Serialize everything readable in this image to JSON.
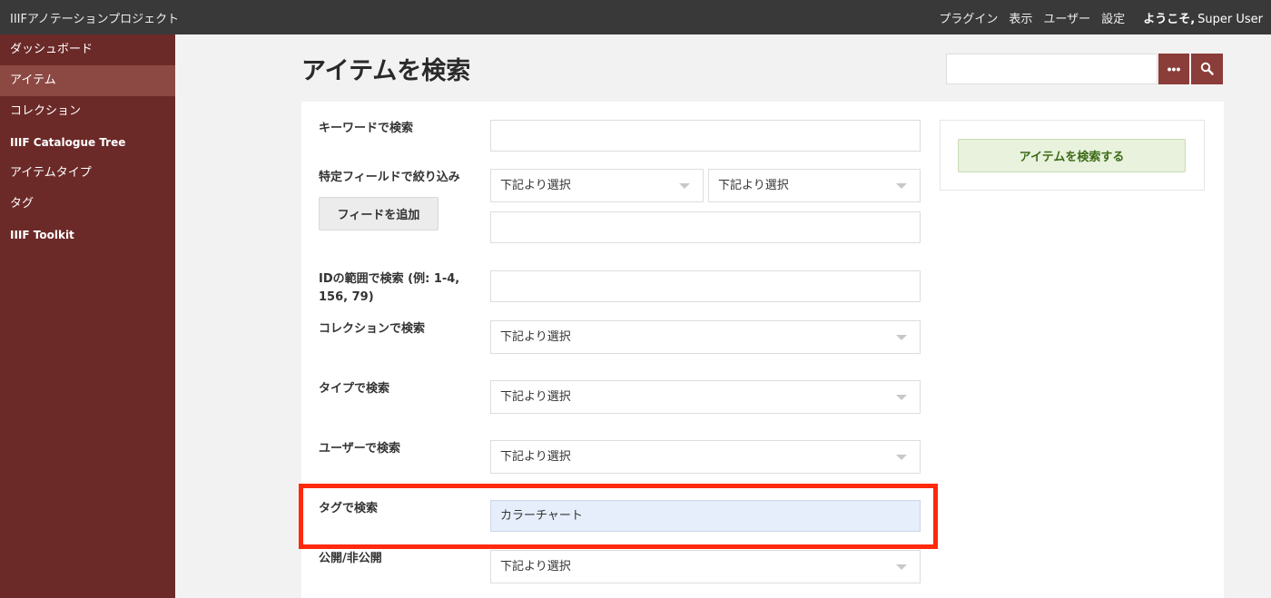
{
  "topbar": {
    "app_title": "IIIFアノテーションプロジェクト",
    "nav": [
      "プラグイン",
      "表示",
      "ユーザー",
      "設定"
    ],
    "welcome_label": "ようこそ,",
    "username": "Super User"
  },
  "sidebar": {
    "items": [
      {
        "label": "ダッシュボード"
      },
      {
        "label": "アイテム",
        "active": true
      },
      {
        "label": "コレクション"
      },
      {
        "label": "IIIF Catalogue Tree"
      },
      {
        "label": "アイテムタイプ"
      },
      {
        "label": "タグ"
      },
      {
        "label": "IIIF Toolkit"
      }
    ]
  },
  "page": {
    "title": "アイテムを検索",
    "top_search_value": "",
    "advanced_button_label": "•••"
  },
  "form": {
    "keyword_label": "キーワードで検索",
    "keyword_value": "",
    "field_filter_label": "特定フィールドで絞り込み",
    "field_select_1": "下記より選択",
    "field_select_2": "下記より選択",
    "field_value": "",
    "add_field_button": "フィードを追加",
    "id_range_label": "IDの範囲で検索 (例: 1-4, 156, 79)",
    "id_range_value": "",
    "collection_label": "コレクションで検索",
    "collection_select": "下記より選択",
    "type_label": "タイプで検索",
    "type_select": "下記より選択",
    "user_label": "ユーザーで検索",
    "user_select": "下記より選択",
    "tag_label": "タグで検索",
    "tag_value": "カラーチャート",
    "public_label": "公開/非公開",
    "public_select": "下記より選択"
  },
  "side_panel": {
    "submit_button": "アイテムを検索する"
  },
  "colors": {
    "topbar": "#393939",
    "sidebar": "#6b2a28",
    "sidebar_active": "#8c4843",
    "accent_button": "#8b3d39",
    "submit_bg": "#e8f2dd",
    "submit_text": "#3d6b16",
    "highlight": "#ff2a0c"
  }
}
